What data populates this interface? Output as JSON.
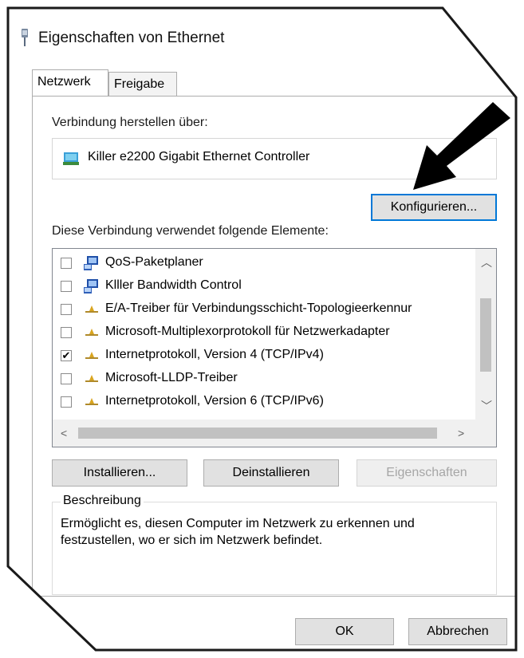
{
  "window": {
    "title": "Eigenschaften von Ethernet"
  },
  "tabs": [
    {
      "label": "Netzwerk",
      "active": true
    },
    {
      "label": "Freigabe",
      "active": false
    }
  ],
  "connect_via": {
    "label": "Verbindung herstellen über:",
    "adapter": "Killer e2200 Gigabit Ethernet Controller"
  },
  "buttons": {
    "configure": "Konfigurieren...",
    "install": "Installieren...",
    "uninstall": "Deinstallieren",
    "properties": "Eigenschaften",
    "ok": "OK",
    "cancel": "Abbrechen"
  },
  "elements": {
    "label": "Diese Verbindung verwendet folgende Elemente:",
    "items": [
      {
        "label": "QoS-Paketplaner",
        "checked": false,
        "icon": "network-service-icon"
      },
      {
        "label": "Klller Bandwidth Control",
        "checked": false,
        "icon": "network-service-icon"
      },
      {
        "label": "E/A-Treiber für Verbindungsschicht-Topologieerkennur",
        "checked": false,
        "icon": "protocol-icon"
      },
      {
        "label": "Microsoft-Multiplexorprotokoll für Netzwerkadapter",
        "checked": false,
        "icon": "protocol-icon"
      },
      {
        "label": "Internetprotokoll, Version 4 (TCP/IPv4)",
        "checked": true,
        "icon": "protocol-icon"
      },
      {
        "label": "Microsoft-LLDP-Treiber",
        "checked": false,
        "icon": "protocol-icon"
      },
      {
        "label": "Internetprotokoll, Version 6 (TCP/IPv6)",
        "checked": false,
        "icon": "protocol-icon"
      }
    ]
  },
  "description": {
    "legend": "Beschreibung",
    "text": "Ermöglicht es, diesen Computer im Netzwerk zu erkennen und festzustellen, wo er sich im Netzwerk befindet."
  },
  "colors": {
    "accent": "#0078d7",
    "disabled_text": "#a6a6a6"
  }
}
